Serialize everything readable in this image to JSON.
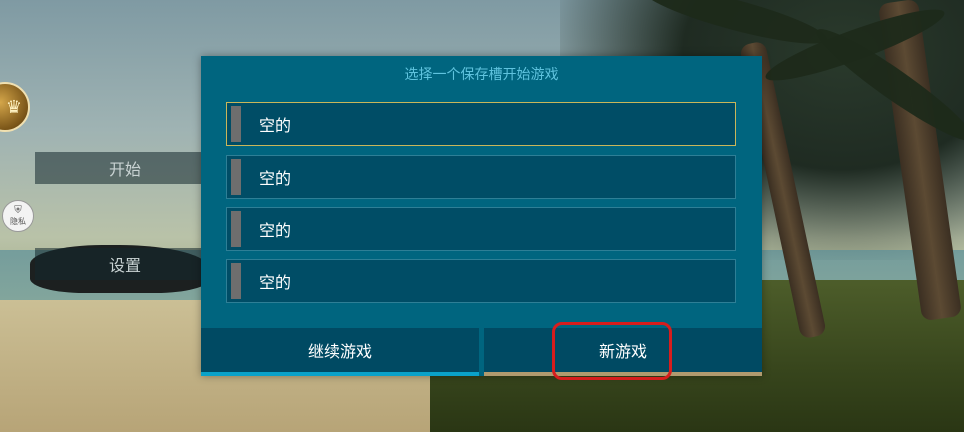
{
  "menu": {
    "start_label": "开始",
    "settings_label": "设置",
    "avatar_icon": "treasure-icon",
    "shield_icon": "privacy-shield-icon",
    "shield_label": "隐私"
  },
  "dialog": {
    "title": "选择一个保存槽开始游戏",
    "slots": [
      {
        "label": "空的",
        "selected": true
      },
      {
        "label": "空的",
        "selected": false
      },
      {
        "label": "空的",
        "selected": false
      },
      {
        "label": "空的",
        "selected": false
      }
    ],
    "continue_label": "继续游戏",
    "new_game_label": "新游戏"
  },
  "colors": {
    "dialog_bg": "#00657f",
    "slot_bg": "#004d66",
    "selected_border": "#c9b65a",
    "title_text": "#5fc3de",
    "highlight": "#d71d1d"
  }
}
